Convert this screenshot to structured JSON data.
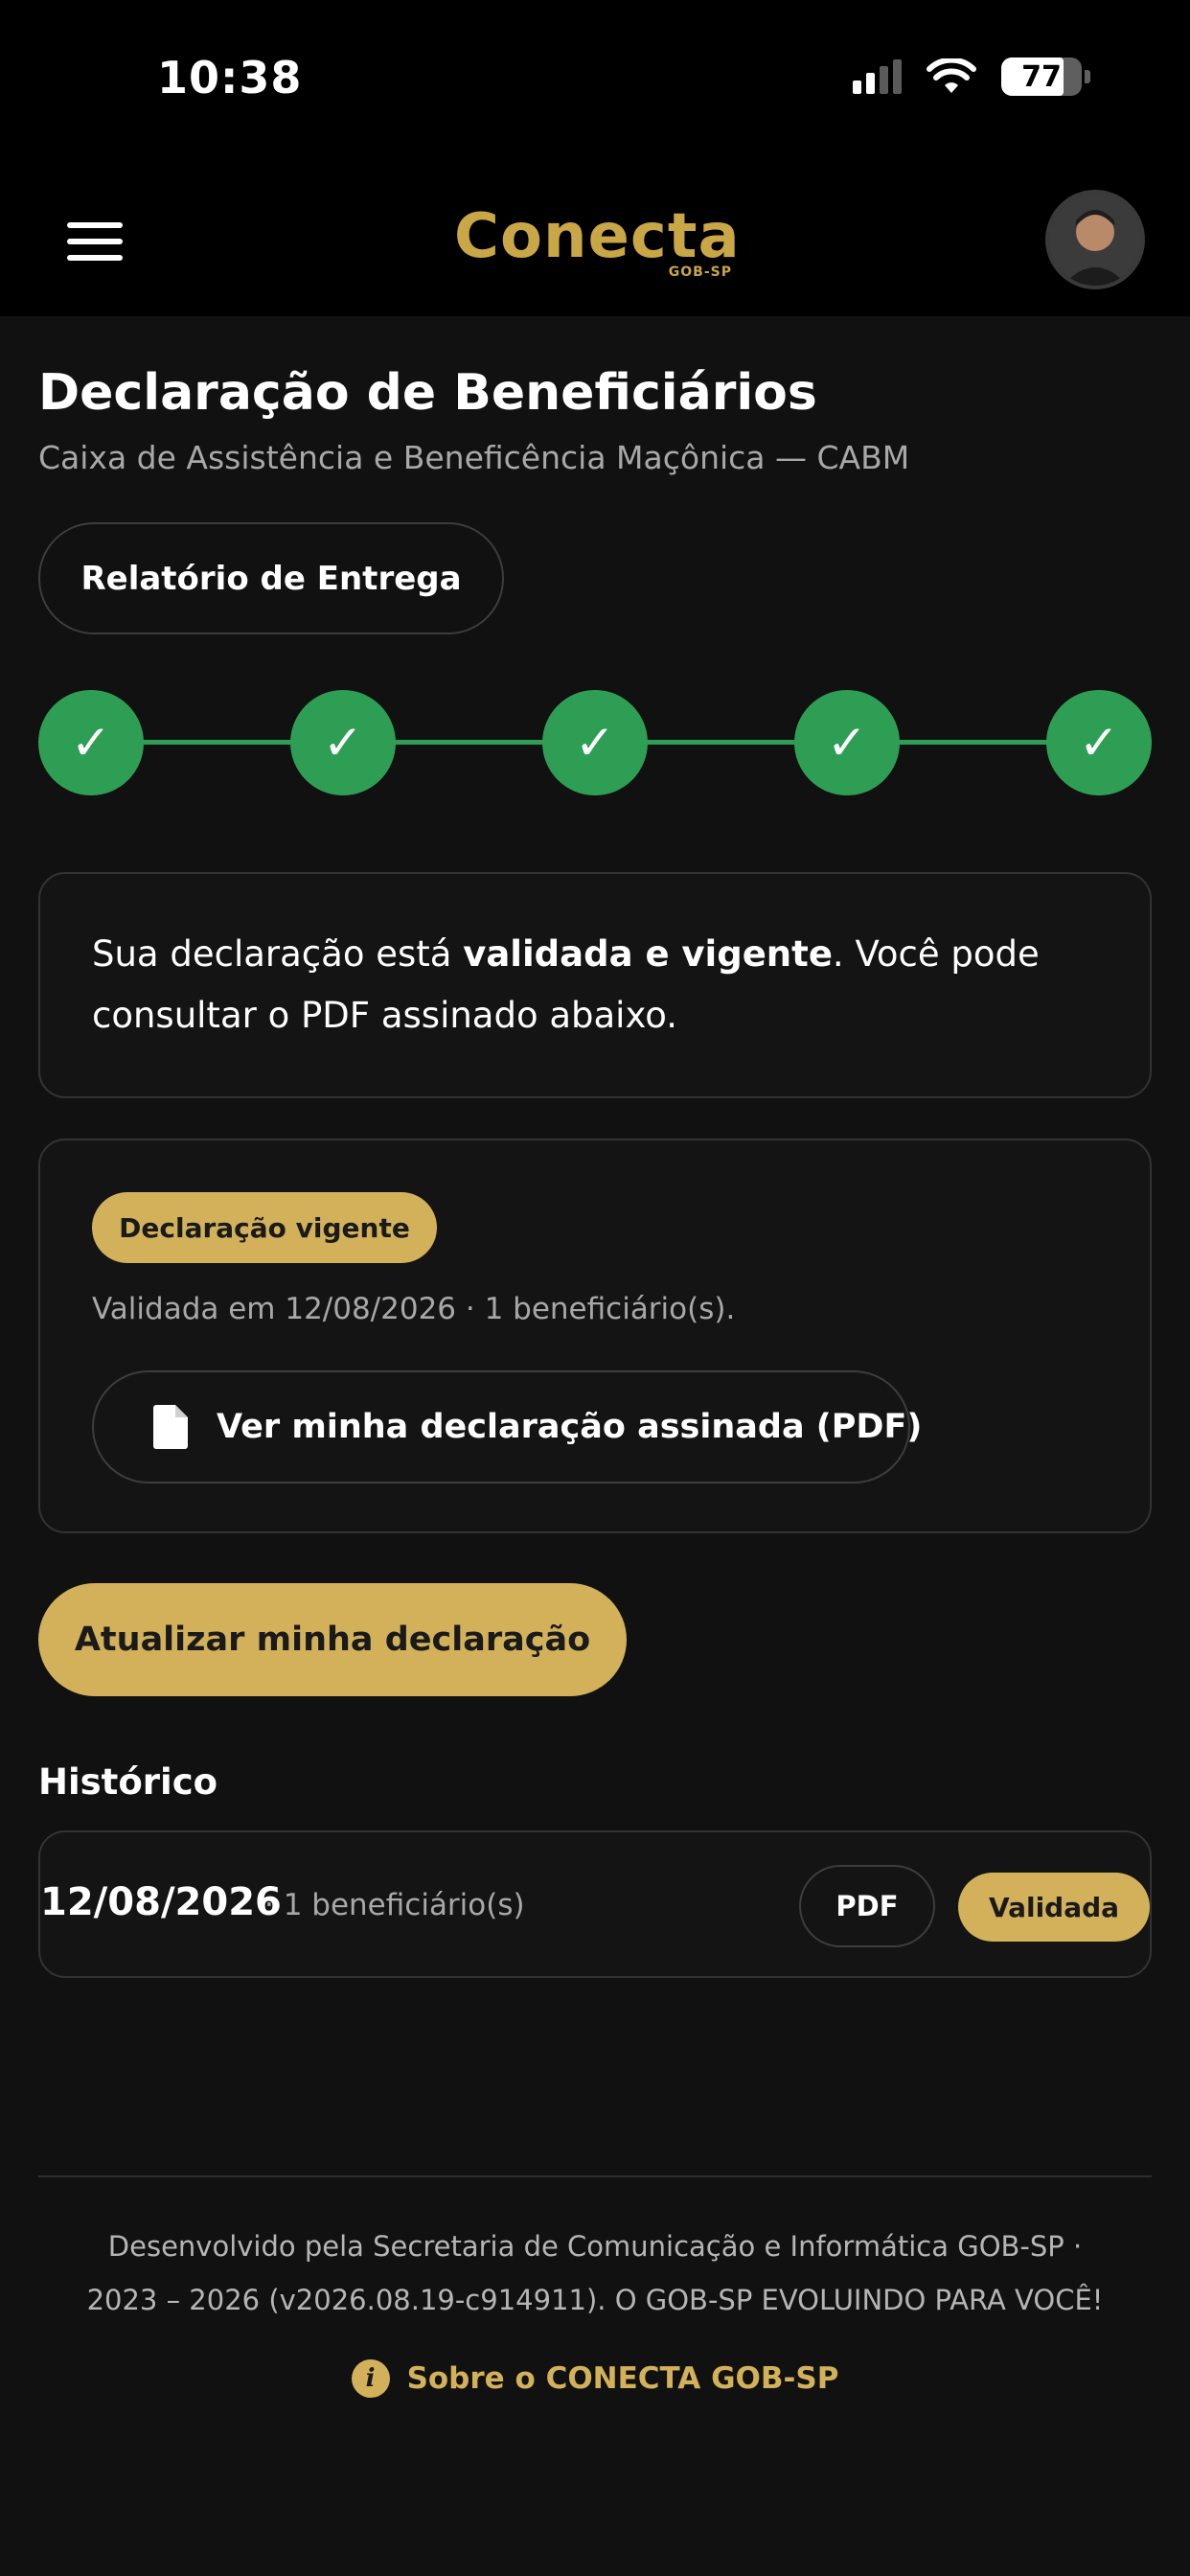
{
  "status_bar": {
    "time": "10:38",
    "battery_level": "77",
    "icons": [
      "signal-icon",
      "wifi-icon",
      "battery-icon"
    ]
  },
  "header": {
    "logo_text": "Conecta",
    "logo_subtext": "GOB-SP",
    "icons": [
      "menu-icon",
      "avatar"
    ]
  },
  "page": {
    "title": "Declaração de Beneficiários",
    "subtitle": "Caixa de Assistência e Beneficência Maçônica — CABM",
    "report_button": "Relatório de Entrega"
  },
  "stepper": {
    "steps_completed": 5,
    "steps_total": 5,
    "check_glyph": "✓",
    "color": "#2f9e55"
  },
  "info_card": {
    "text_before": "Sua declaração está ",
    "text_bold": "validada e vigente",
    "text_after": ". Você pode consultar o PDF assinado abaixo."
  },
  "status_card": {
    "badge": "Declaração vigente",
    "validated_line": "Validada em 12/08/2026 · 1 beneficiário(s).",
    "pdf_button": "Ver minha declaração assinada (PDF)",
    "pdf_icon": "document-icon"
  },
  "actions": {
    "update_button": "Atualizar minha declaração"
  },
  "history": {
    "title": "Histórico",
    "rows": [
      {
        "date": "12/08/2026",
        "meta": "· 1 beneficiário(s)",
        "pdf_label": "PDF",
        "status": "Validada"
      }
    ]
  },
  "footer": {
    "line1": "Desenvolvido pela Secretaria de Comunicação e Informática GOB-SP ·",
    "line2": "2023 – 2026 (v2026.08.19-c914911). O GOB-SP EVOLUINDO PARA VOCÊ!",
    "link": "Sobre o CONECTA GOB-SP",
    "link_icon": "info-icon"
  },
  "colors": {
    "background": "#111111",
    "header": "#000000",
    "accent_gold": "#d2b15a",
    "success_green": "#2f9e55",
    "muted_text": "#a8a8a8"
  }
}
